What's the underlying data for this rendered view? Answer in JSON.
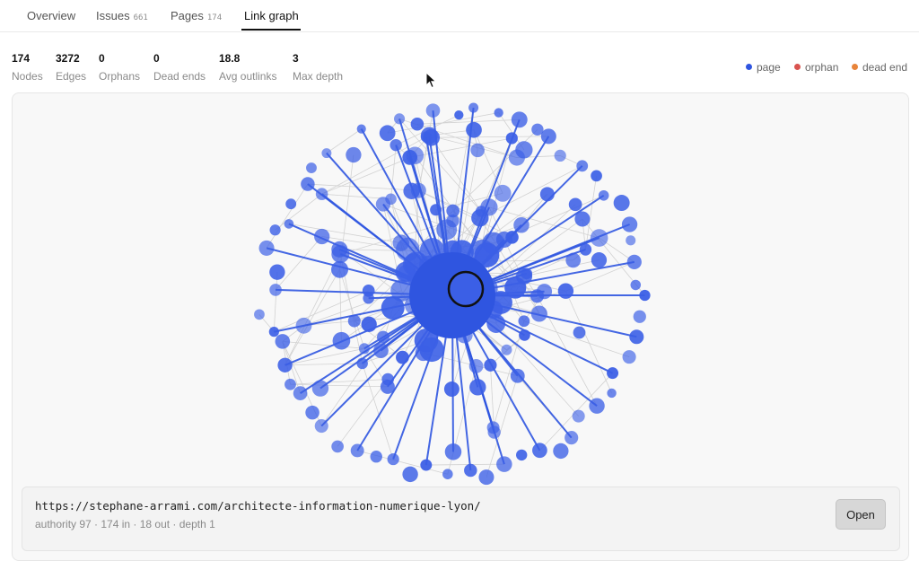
{
  "tabs": [
    {
      "label": "Overview",
      "count": ""
    },
    {
      "label": "Issues",
      "count": "661"
    },
    {
      "label": "Pages",
      "count": "174"
    },
    {
      "label": "Link graph",
      "count": ""
    }
  ],
  "active_tab": "Link graph",
  "stats": [
    {
      "value": "174",
      "label": "Nodes"
    },
    {
      "value": "3272",
      "label": "Edges"
    },
    {
      "value": "0",
      "label": "Orphans"
    },
    {
      "value": "0",
      "label": "Dead ends"
    },
    {
      "value": "18.8",
      "label": "Avg outlinks"
    },
    {
      "value": "3",
      "label": "Max depth"
    }
  ],
  "legend": [
    {
      "label": "page",
      "color": "#2f55e0"
    },
    {
      "label": "orphan",
      "color": "#d9534f"
    },
    {
      "label": "dead end",
      "color": "#e8843a"
    }
  ],
  "graph": {
    "node_color": "#3b5fe6",
    "edge_color": "#d2d2d2",
    "selected_outline": "#111111",
    "node_count": 174,
    "edge_count": 3272
  },
  "selected": {
    "url": "https://stephane-arrami.com/architecte-information-numerique-lyon/",
    "meta": "authority 97 · 174 in · 18 out · depth 1",
    "open_label": "Open"
  }
}
